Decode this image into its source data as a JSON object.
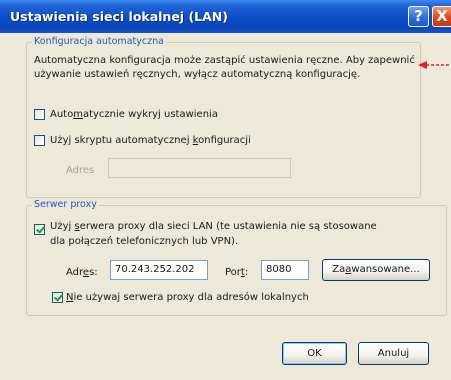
{
  "window": {
    "title": "Ustawienia sieci lokalnej (LAN)",
    "help_glyph": "?",
    "close_glyph": "X"
  },
  "auto_config": {
    "legend": "Konfiguracja automatyczna",
    "desc_line1": "Automatyczna konfiguracja może zastąpić ustawienia ręczne. Aby zapewnić",
    "desc_line2": "używanie ustawień ręcznych, wyłącz automatyczną konfigurację.",
    "auto_detect": {
      "pre": "Auto",
      "mnemonic": "m",
      "post": "atycznie wykryj ustawienia",
      "checked": false
    },
    "use_script": {
      "pre": "Użyj skryptu automatycznej ",
      "mnemonic": "k",
      "post": "onfiguracji",
      "checked": false
    },
    "address_label": "Adres",
    "address_value": ""
  },
  "proxy": {
    "legend": "Serwer proxy",
    "use_proxy_line1": {
      "pre": "Użyj ",
      "mnemonic": "s",
      "post": "erwera proxy dla sieci LAN (te ustawienia nie są stosowane"
    },
    "use_proxy_line2": "dla połączeń telefonicznych lub VPN).",
    "use_proxy_checked": true,
    "address_label": {
      "pre": "Adr",
      "mnemonic": "e",
      "post": "s:"
    },
    "address_value": "70.243.252.202",
    "port_label": {
      "pre": "Por",
      "mnemonic": "t",
      "post": ":"
    },
    "port_value": "8080",
    "advanced_button": {
      "pre": "Za",
      "mnemonic": "a",
      "post": "wansowane..."
    },
    "bypass_local": {
      "pre": "",
      "mnemonic": "N",
      "post": "ie używaj serwera proxy dla adresów lokalnych",
      "checked": true
    }
  },
  "buttons": {
    "ok": "OK",
    "cancel": "Anuluj"
  },
  "colors": {
    "title_bar": "#0d4cc4",
    "dialog_bg": "#ece9d8",
    "legend_text": "#2456c8",
    "annotation_arrow": "#e32222"
  }
}
